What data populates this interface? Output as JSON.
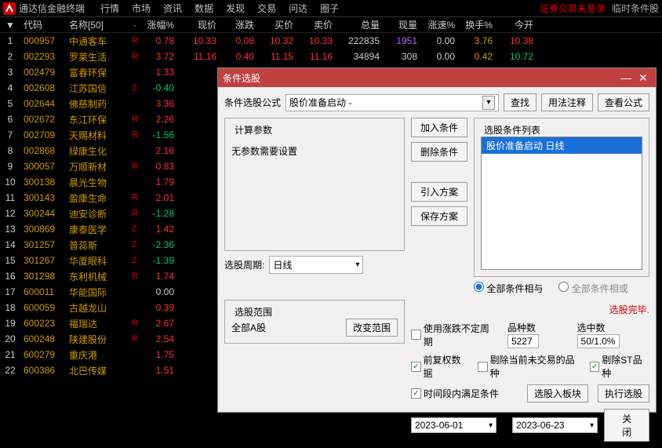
{
  "app": {
    "title": "通达信金融终端"
  },
  "menu": [
    "行情",
    "市场",
    "资讯",
    "数据",
    "发现",
    "交易",
    "问达",
    "圈子"
  ],
  "menu_right": {
    "login": "证券交易未登录",
    "mode": "临时条件股"
  },
  "headers": {
    "code": "代码",
    "name": "名称[50]",
    "pct": "涨幅%",
    "price": "现价",
    "chg": "涨跌",
    "bid": "买价",
    "ask": "卖价",
    "vol": "总量",
    "cur": "现量",
    "spd": "涨速%",
    "turn": "换手%",
    "open": "今开"
  },
  "rows": [
    {
      "idx": 1,
      "code": "000957",
      "name": "中通客车",
      "flag": "R",
      "pct": "0.78",
      "pctC": "up",
      "price": "10.33",
      "chg": "0.08",
      "bid": "10.32",
      "ask": "10.33",
      "vol": "222835",
      "cur": "1951",
      "curC": "purple",
      "spd": "0.00",
      "turn": "3.76",
      "open": "10.38",
      "openC": "up"
    },
    {
      "idx": 2,
      "code": "002293",
      "name": "罗莱生活",
      "flag": "R",
      "pct": "3.72",
      "pctC": "up",
      "price": "11.16",
      "chg": "0.40",
      "bid": "11.15",
      "ask": "11.16",
      "vol": "34894",
      "cur": "308",
      "curC": "neutral",
      "spd": "0.00",
      "turn": "0.42",
      "open": "10.72",
      "openC": "down"
    },
    {
      "idx": 3,
      "code": "002479",
      "name": "富春环保",
      "flag": "",
      "pct": "1.33",
      "pctC": "up"
    },
    {
      "idx": 4,
      "code": "002608",
      "name": "江苏国信",
      "flag": "Z",
      "pct": "-0.40",
      "pctC": "down"
    },
    {
      "idx": 5,
      "code": "002644",
      "name": "佛慈制药",
      "flag": "",
      "pct": "3.36",
      "pctC": "up"
    },
    {
      "idx": 6,
      "code": "002672",
      "name": "东江环保",
      "flag": "R",
      "pct": "2.26",
      "pctC": "up"
    },
    {
      "idx": 7,
      "code": "002709",
      "name": "天赐材料",
      "flag": "R",
      "pct": "-1.56",
      "pctC": "down"
    },
    {
      "idx": 8,
      "code": "002868",
      "name": "绿康生化",
      "flag": "",
      "pct": "2.18",
      "pctC": "up"
    },
    {
      "idx": 9,
      "code": "300057",
      "name": "万顺新材",
      "flag": "R",
      "pct": "0.83",
      "pctC": "up"
    },
    {
      "idx": 10,
      "code": "300138",
      "name": "晨光生物",
      "flag": "",
      "pct": "1.79",
      "pctC": "up"
    },
    {
      "idx": 11,
      "code": "300143",
      "name": "盈康生命",
      "flag": "R",
      "pct": "2.01",
      "pctC": "up"
    },
    {
      "idx": 12,
      "code": "300244",
      "name": "迪安诊断",
      "flag": "R",
      "pct": "-1.28",
      "pctC": "down"
    },
    {
      "idx": 13,
      "code": "300869",
      "name": "康泰医学",
      "flag": "Z",
      "pct": "1.42",
      "pctC": "up"
    },
    {
      "idx": 14,
      "code": "301257",
      "name": "普蕊斯",
      "flag": "Z",
      "pct": "-2.36",
      "pctC": "down"
    },
    {
      "idx": 15,
      "code": "301267",
      "name": "华厦眼科",
      "flag": "Z",
      "pct": "-1.39",
      "pctC": "down"
    },
    {
      "idx": 16,
      "code": "301298",
      "name": "东利机械",
      "flag": "R",
      "pct": "1.74",
      "pctC": "up"
    },
    {
      "idx": 17,
      "code": "600011",
      "name": "华能国际",
      "flag": "",
      "pct": "0.00",
      "pctC": "neutral"
    },
    {
      "idx": 18,
      "code": "600059",
      "name": "古越龙山",
      "flag": "",
      "pct": "0.39",
      "pctC": "up"
    },
    {
      "idx": 19,
      "code": "600223",
      "name": "福瑞达",
      "flag": "R",
      "pct": "2.67",
      "pctC": "up"
    },
    {
      "idx": 20,
      "code": "600248",
      "name": "陕建股份",
      "flag": "R",
      "pct": "2.54",
      "pctC": "up"
    },
    {
      "idx": 21,
      "code": "600279",
      "name": "重庆港",
      "flag": "",
      "pct": "1.75",
      "pctC": "up"
    },
    {
      "idx": 22,
      "code": "600386",
      "name": "北巴传媒",
      "flag": "",
      "pct": "1.51",
      "pctC": "up"
    }
  ],
  "dlg": {
    "title": "条件选股",
    "formula_label": "条件选股公式",
    "formula_value": "股价准备启动 -",
    "find": "查找",
    "usage": "用法注释",
    "view": "查看公式",
    "calc_params": "计算参数",
    "no_params": "无参数需要设置",
    "cond_list_label": "选股条件列表",
    "add": "加入条件",
    "del": "删除条件",
    "import": "引入方案",
    "save": "保存方案",
    "cond_item": "股价准备启动 日线",
    "period_label": "选股周期:",
    "period_value": "日线",
    "range_label": "选股范围",
    "range_value": "全部A股",
    "change_range": "改变范围",
    "radio_and": "全部条件相与",
    "radio_or": "全部条件相或",
    "status": "选股完毕.",
    "uncertain": "使用涨跌不定周期",
    "count_label": "品种数",
    "count_value": "5227",
    "sel_label": "选中数",
    "sel_value": "50/1.0%",
    "fq": "前复权数据",
    "rm_nt": "剔除当前未交易的品种",
    "rm_st": "剔除ST品种",
    "time_cond": "时间段内满足条件",
    "to_block": "选股入板块",
    "exec": "执行选股",
    "date1": "2023-06-01",
    "date_sep": "-",
    "date2": "2023-06-23",
    "close": "关闭"
  }
}
